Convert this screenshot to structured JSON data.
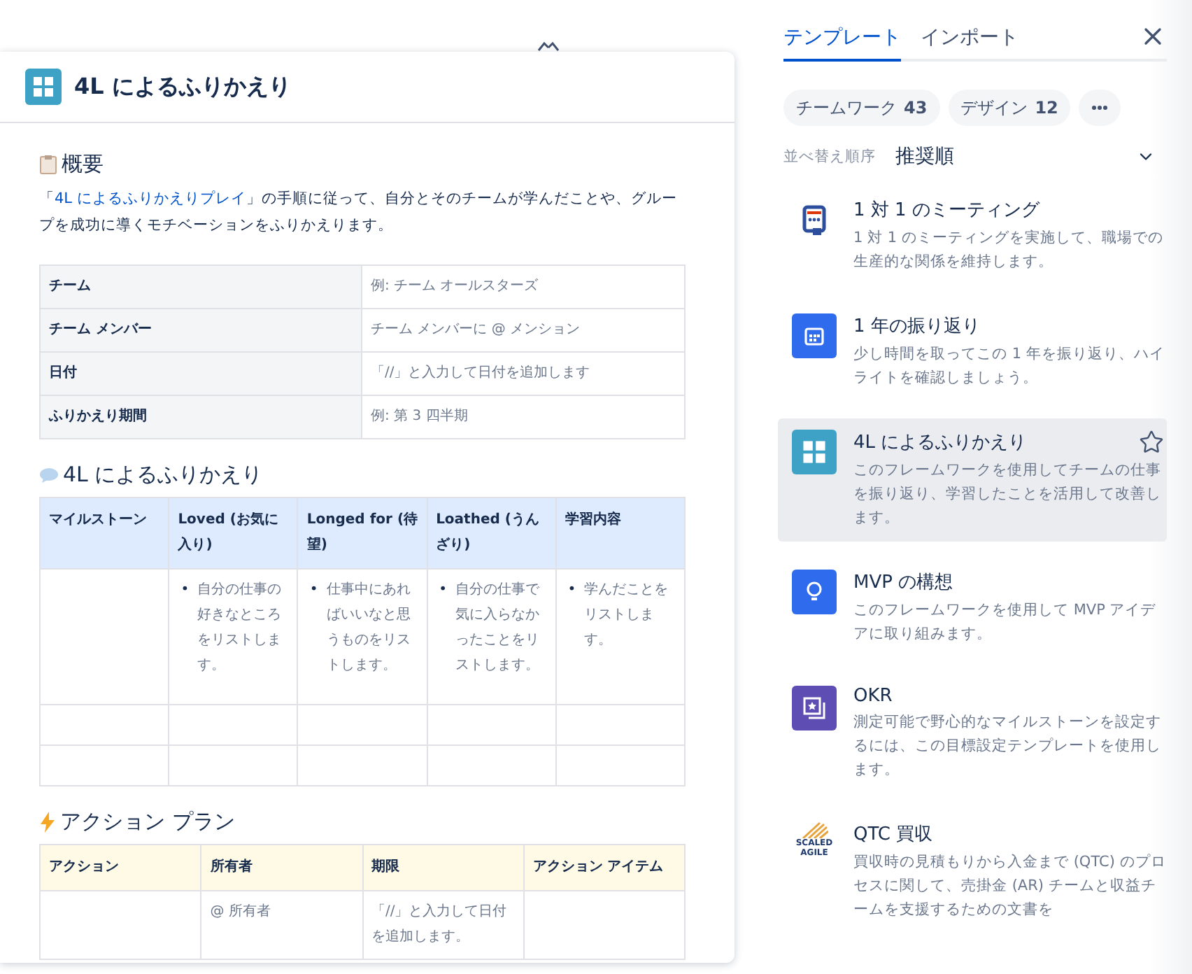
{
  "document": {
    "title": "4L によるふりかえり",
    "overview": {
      "heading": "概要",
      "intro": {
        "before": "「",
        "link": "4L によるふりかえりプレイ",
        "after": "」の手順に従って、自分とそのチームが学んだことや、グループを成功に導くモチベーションをふりかえります。"
      },
      "rows": [
        {
          "label": "チーム",
          "value": "例: チーム オールスターズ"
        },
        {
          "label": "チーム メンバー",
          "value": "チーム メンバーに @ メンション"
        },
        {
          "label": "日付",
          "value": "「//」と入力して日付を追加します"
        },
        {
          "label": "ふりかえり期間",
          "value": "例: 第 3 四半期"
        }
      ]
    },
    "retro": {
      "heading": "4L によるふりかえり",
      "marker": "•",
      "columns": [
        "マイルストーン",
        "Loved (お気に入り)",
        "Longed for (待望)",
        "Loathed (うんざり)",
        "学習内容"
      ],
      "rows": [
        {
          "cells": [
            null,
            "自分の仕事の好きなところをリストします。",
            "仕事中にあればいいなと思うものをリストします。",
            "自分の仕事で気に入らなかったことをリストします。",
            "学んだことをリストします。"
          ]
        },
        {
          "cells": [
            null,
            null,
            null,
            null,
            null
          ]
        },
        {
          "cells": [
            null,
            null,
            null,
            null,
            null
          ]
        }
      ]
    },
    "actions": {
      "heading": "アクション プラン",
      "columns": [
        "アクション",
        "所有者",
        "期限",
        "アクション アイテム"
      ],
      "rows": [
        {
          "cells": [
            null,
            "@ 所有者",
            "「//」と入力して日付を追加します。",
            null
          ]
        }
      ]
    }
  },
  "panel": {
    "tabs": [
      {
        "label": "テンプレート",
        "selected": true
      },
      {
        "label": "インポート",
        "selected": false
      }
    ],
    "chips": [
      {
        "label": "チームワーク",
        "count": "43"
      },
      {
        "label": "デザイン",
        "count": "12"
      }
    ],
    "sort": {
      "label": "並べ替え順序",
      "value": "推奨順"
    },
    "templates": [
      {
        "kind": "meeting",
        "title": "1 対 1 のミーティング",
        "description": "1 対 1 のミーティングを実施して、職場での生産的な関係を維持します。",
        "selected": false
      },
      {
        "kind": "calendar",
        "title": "1 年の振り返り",
        "description": "少し時間を取ってこの 1 年を振り返り、ハイライトを確認しましょう。",
        "selected": false
      },
      {
        "kind": "grid",
        "title": "4L によるふりかえり",
        "description": "このフレームワークを使用してチームの仕事を振り返り、学習したことを活用して改善します。",
        "selected": true
      },
      {
        "kind": "bulb",
        "title": "MVP の構想",
        "description": "このフレームワークを使用して MVP アイデアに取り組みます。",
        "selected": false
      },
      {
        "kind": "okr",
        "title": "OKR",
        "description": "測定可能で野心的なマイルストーンを設定するには、この目標設定テンプレートを使用します。",
        "selected": false
      },
      {
        "kind": "logo",
        "logo_text": [
          "SCALED",
          "AGILE"
        ],
        "title": "QTC 買収",
        "description": "買収時の見積もりから入金まで (QTC) のプロセスに関して、売掛金 (AR) チームと収益チームを支援するための文書を",
        "selected": false
      }
    ]
  }
}
